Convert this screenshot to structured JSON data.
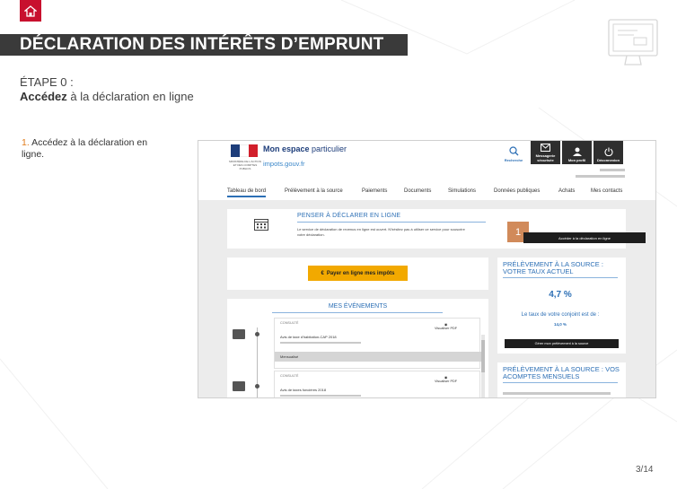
{
  "header": {
    "home_icon": "home-icon",
    "title": "DÉCLARATION DES INTÉRÊTS D’EMPRUNT",
    "screen_icon": "computer-screen-icon"
  },
  "step": {
    "label": "ÉTAPE 0 :",
    "action_bold": "Accédez",
    "action_rest": " à la déclaration en ligne"
  },
  "instructions": [
    {
      "num": "1.",
      "text": " Accédez à la déclaration en ligne."
    }
  ],
  "screenshot": {
    "brand": {
      "prefix": "Mon espace",
      "suffix": " particulier",
      "site": "impots.gouv.fr",
      "marianne": "MINISTÈRE DE L'ACTION ET DES COMPTES PUBLICS"
    },
    "toolbar": [
      {
        "label": "Recherche",
        "icon": "search-icon"
      },
      {
        "label": "Messagerie sécurisée",
        "icon": "mail-icon"
      },
      {
        "label": "Mon profil",
        "icon": "user-icon"
      },
      {
        "label": "Déconnexion",
        "icon": "power-icon"
      }
    ],
    "nav": [
      "Tableau de bord",
      "Prélèvement à la source",
      "Paiements",
      "Documents",
      "Simulations",
      "Données publiques",
      "Achats",
      "Mes contacts"
    ],
    "penser": {
      "title": "PENSER À DÉCLARER EN LIGNE",
      "text": "Le service de déclaration de revenus en ligne est ouvert. N'hésitez pas à utiliser ce service pour souscrire votre déclaration.",
      "button": "Accéder à la déclaration en ligne",
      "badge": "1",
      "icon": "calendar-icon"
    },
    "pay_button": "Payer en ligne mes impôts",
    "pay_icon": "euro-icon",
    "prelevement": {
      "title": "PRÉLÈVEMENT À LA SOURCE : VOTRE TAUX ACTUEL",
      "rate": "4,7 %",
      "conjoint_label": "Le taux de votre conjoint est de :",
      "conjoint_rate": "14,0 %",
      "button": "Gérer mon prélèvement à la source"
    },
    "acomptes": {
      "title": "PRÉLÈVEMENT À LA SOURCE : VOS ACOMPTES MENSUELS"
    },
    "events": {
      "title": "MES ÉVÉNEMENTS",
      "items": [
        {
          "tag": "CONSULTÉ",
          "name": "Avis de taxe d'habitation-CAP 2018",
          "action": "Visualiser PDF",
          "sub": "Mensualisé"
        },
        {
          "tag": "CONSULTÉ",
          "name": "Avis de taxes foncières 2018",
          "action": "Visualiser PDF"
        }
      ]
    }
  },
  "pager": "3/14",
  "colors": {
    "brand_red": "#c8102e",
    "dark_bar": "#3a3a3a",
    "accent_blue": "#2c6fb5",
    "orange_num": "#e07b1a",
    "badge": "#d18a5a",
    "pay_yellow": "#f2a900"
  }
}
